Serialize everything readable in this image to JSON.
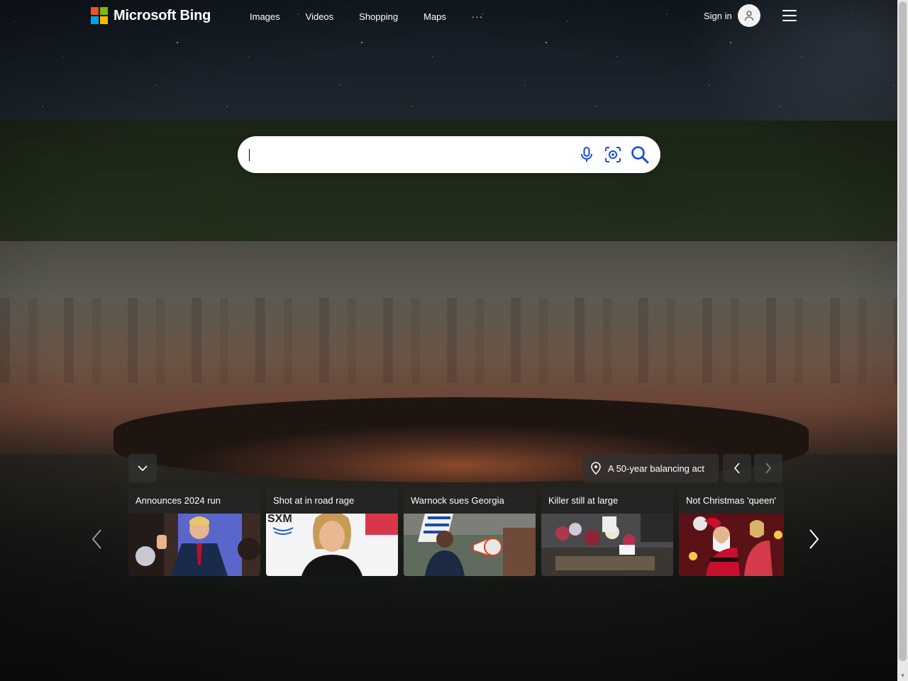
{
  "header": {
    "logo_text": "Microsoft Bing",
    "nav": [
      "Images",
      "Videos",
      "Shopping",
      "Maps"
    ],
    "more_label": "···",
    "signin_label": "Sign in"
  },
  "search": {
    "value": "",
    "placeholder": ""
  },
  "image_info": {
    "caption": "A 50-year balancing act"
  },
  "news_cards": [
    {
      "title": "Announces 2024 run"
    },
    {
      "title": "Shot at in road rage"
    },
    {
      "title": "Warnock sues Georgia"
    },
    {
      "title": "Killer still at large"
    },
    {
      "title": "Not Christmas 'queen'"
    }
  ],
  "colors": {
    "ms_red": "#f25022",
    "ms_green": "#7fba00",
    "ms_blue": "#00a4ef",
    "ms_yellow": "#ffb900",
    "search_icon_blue": "#174ae4"
  },
  "icons": [
    "microphone-icon",
    "visual-search-icon",
    "search-icon",
    "location-pin-icon",
    "chevron-down-icon",
    "chevron-left-icon",
    "chevron-right-icon",
    "user-icon",
    "hamburger-menu-icon"
  ]
}
